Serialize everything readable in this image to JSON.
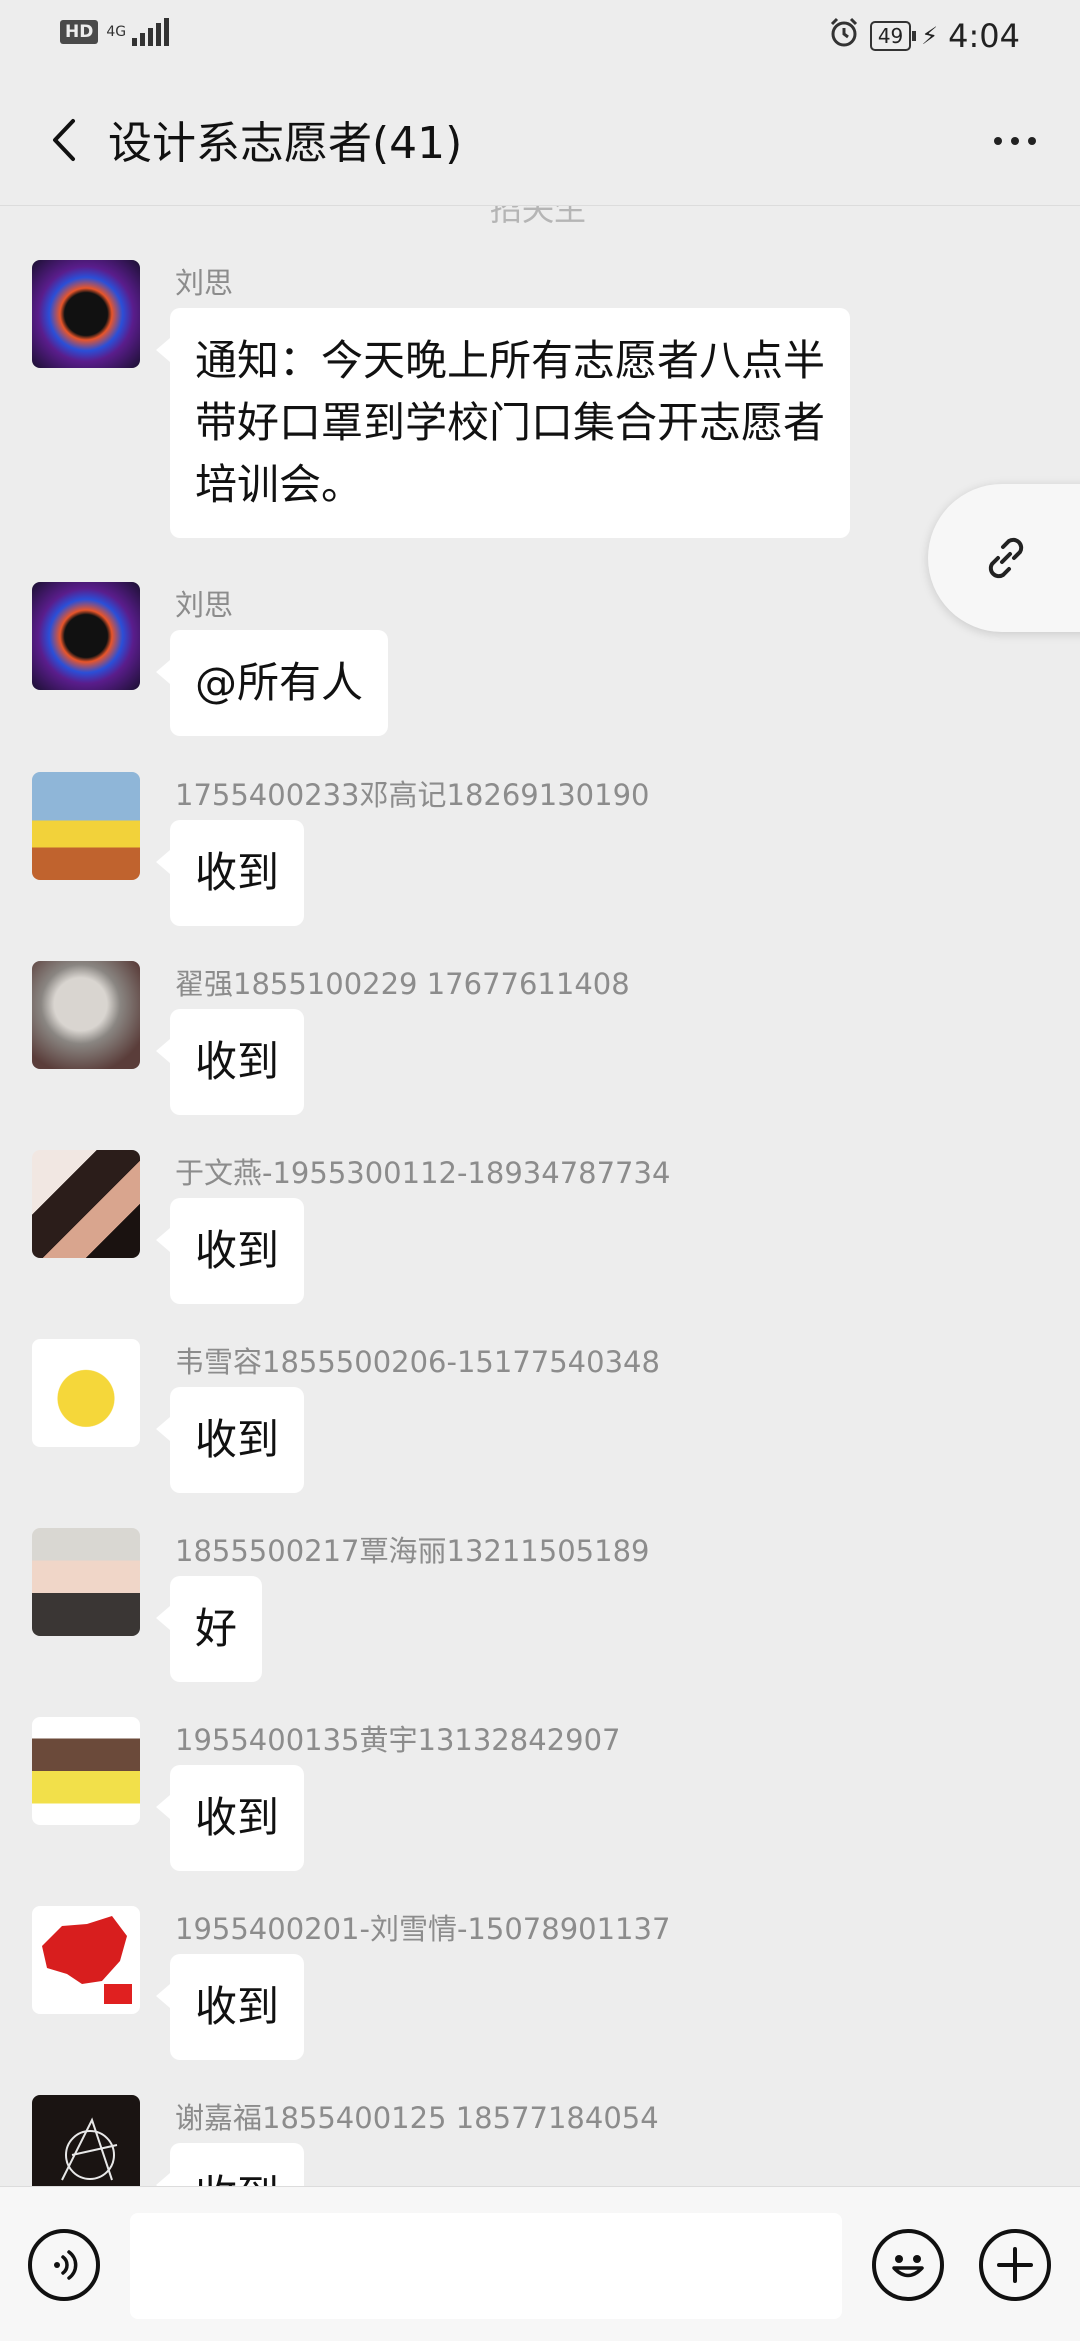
{
  "status_bar": {
    "hd": "HD",
    "network": "4G",
    "battery": "49",
    "time": "4:04"
  },
  "header": {
    "title": "设计系志愿者(41)"
  },
  "chat": {
    "cut_off_text": "招失生",
    "messages": [
      {
        "sender": "刘思",
        "text": "通知：今天晚上所有志愿者八点半带好口罩到学校门口集合开志愿者培训会。"
      },
      {
        "sender": "刘思",
        "text": "@所有人"
      },
      {
        "sender": "1755400233邓高记18269130190",
        "text": "收到"
      },
      {
        "sender": "翟强1855100229 17677611408",
        "text": "收到"
      },
      {
        "sender": "于文燕-1955300112-18934787734",
        "text": "收到"
      },
      {
        "sender": "韦雪容1855500206-15177540348",
        "text": "收到"
      },
      {
        "sender": "1855500217覃海丽13211505189",
        "text": "好"
      },
      {
        "sender": "1955400135黄宇13132842907",
        "text": "收到"
      },
      {
        "sender": "1955400201-刘雪情-15078901137",
        "text": "收到"
      },
      {
        "sender": "谢嘉福1855400125     18577184054",
        "text": "收到"
      }
    ]
  },
  "input_bar": {
    "value": "",
    "placeholder": ""
  },
  "icons": {
    "back": "chevron-left-icon",
    "more": "more-horizontal-icon",
    "link": "link-icon",
    "voice": "voice-icon",
    "emoji": "emoji-icon",
    "plus": "plus-icon"
  }
}
